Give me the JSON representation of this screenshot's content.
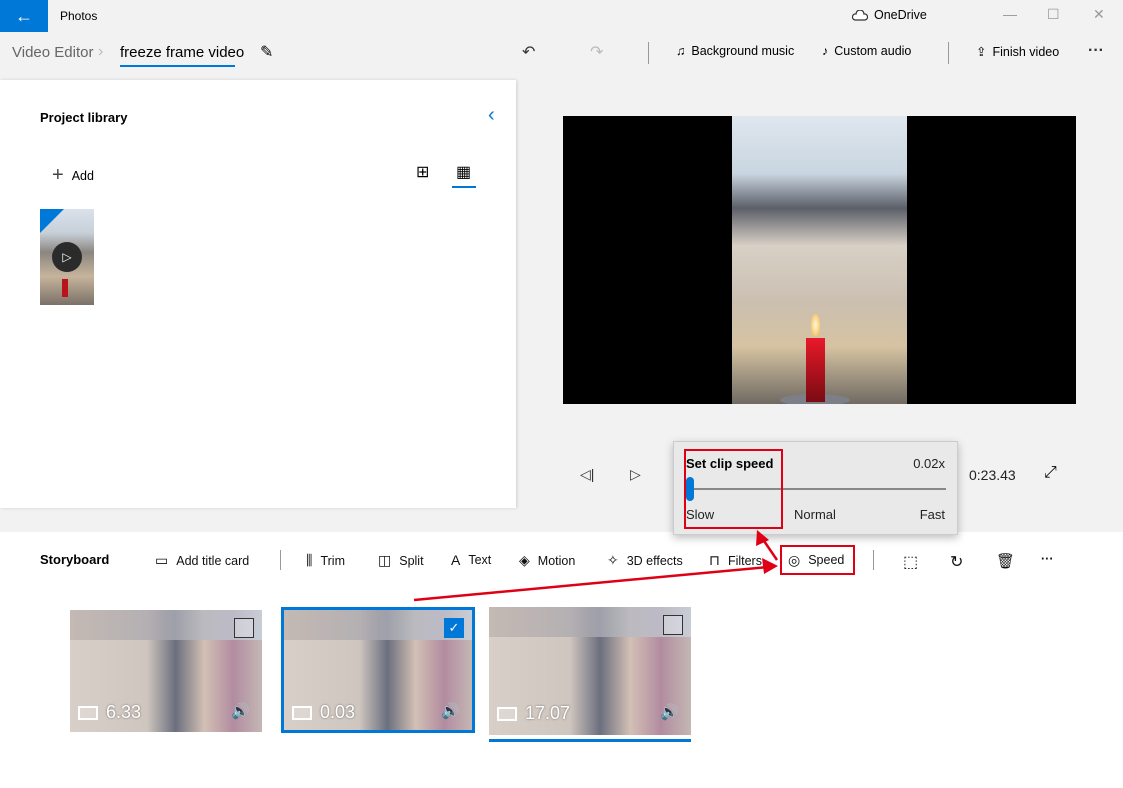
{
  "titlebar": {
    "app_title": "Photos",
    "onedrive_label": "OneDrive",
    "minimize": "—",
    "maximize": "☐",
    "close": "✕",
    "back": "←"
  },
  "breadcrumb": {
    "root": "Video Editor",
    "separator": "›",
    "current": "freeze frame video"
  },
  "toolbar": {
    "undo": "↶",
    "redo": "↷",
    "background_music": "Background music",
    "custom_audio": "Custom audio",
    "finish_video": "Finish video",
    "more": "···",
    "icons": {
      "background_music": "♫",
      "custom_audio": "♪",
      "finish_video": "⇪"
    }
  },
  "library": {
    "title": "Project library",
    "collapse": "‹",
    "add_label": "Add",
    "add_icon": "+",
    "view_large": "⊞",
    "view_small": "▦",
    "thumb_play": "▷"
  },
  "player": {
    "prev_frame": "◁|",
    "play": "▷",
    "time": "0:23.43",
    "fullscreen": "⤢"
  },
  "speed_popup": {
    "title": "Set clip speed",
    "value": "0.02x",
    "slider_fraction": 0.0,
    "label_slow": "Slow",
    "label_normal": "Normal",
    "label_fast": "Fast"
  },
  "storyboard": {
    "title": "Storyboard",
    "actions": [
      {
        "label": "Add title card",
        "icon": "▭"
      },
      {
        "label": "Trim",
        "icon": "⫼"
      },
      {
        "label": "Split",
        "icon": "◫"
      },
      {
        "label": "Text",
        "icon": "A"
      },
      {
        "label": "Motion",
        "icon": "◈"
      },
      {
        "label": "3D effects",
        "icon": "✧"
      },
      {
        "label": "Filters",
        "icon": "⊓"
      },
      {
        "label": "Speed",
        "icon": "◎"
      }
    ],
    "icon_actions": {
      "resize": "⬚",
      "rotate": "↻",
      "delete": "🗑",
      "more": "···"
    },
    "clips": [
      {
        "duration": "6.33",
        "selected": false,
        "volume": "🔊"
      },
      {
        "duration": "0.03",
        "selected": true,
        "volume": "🔊",
        "check": "✓"
      },
      {
        "duration": "17.07",
        "selected": false,
        "volume": "🔊"
      }
    ]
  },
  "colors": {
    "accent": "#0078d7",
    "annotation_red": "#e00016"
  }
}
